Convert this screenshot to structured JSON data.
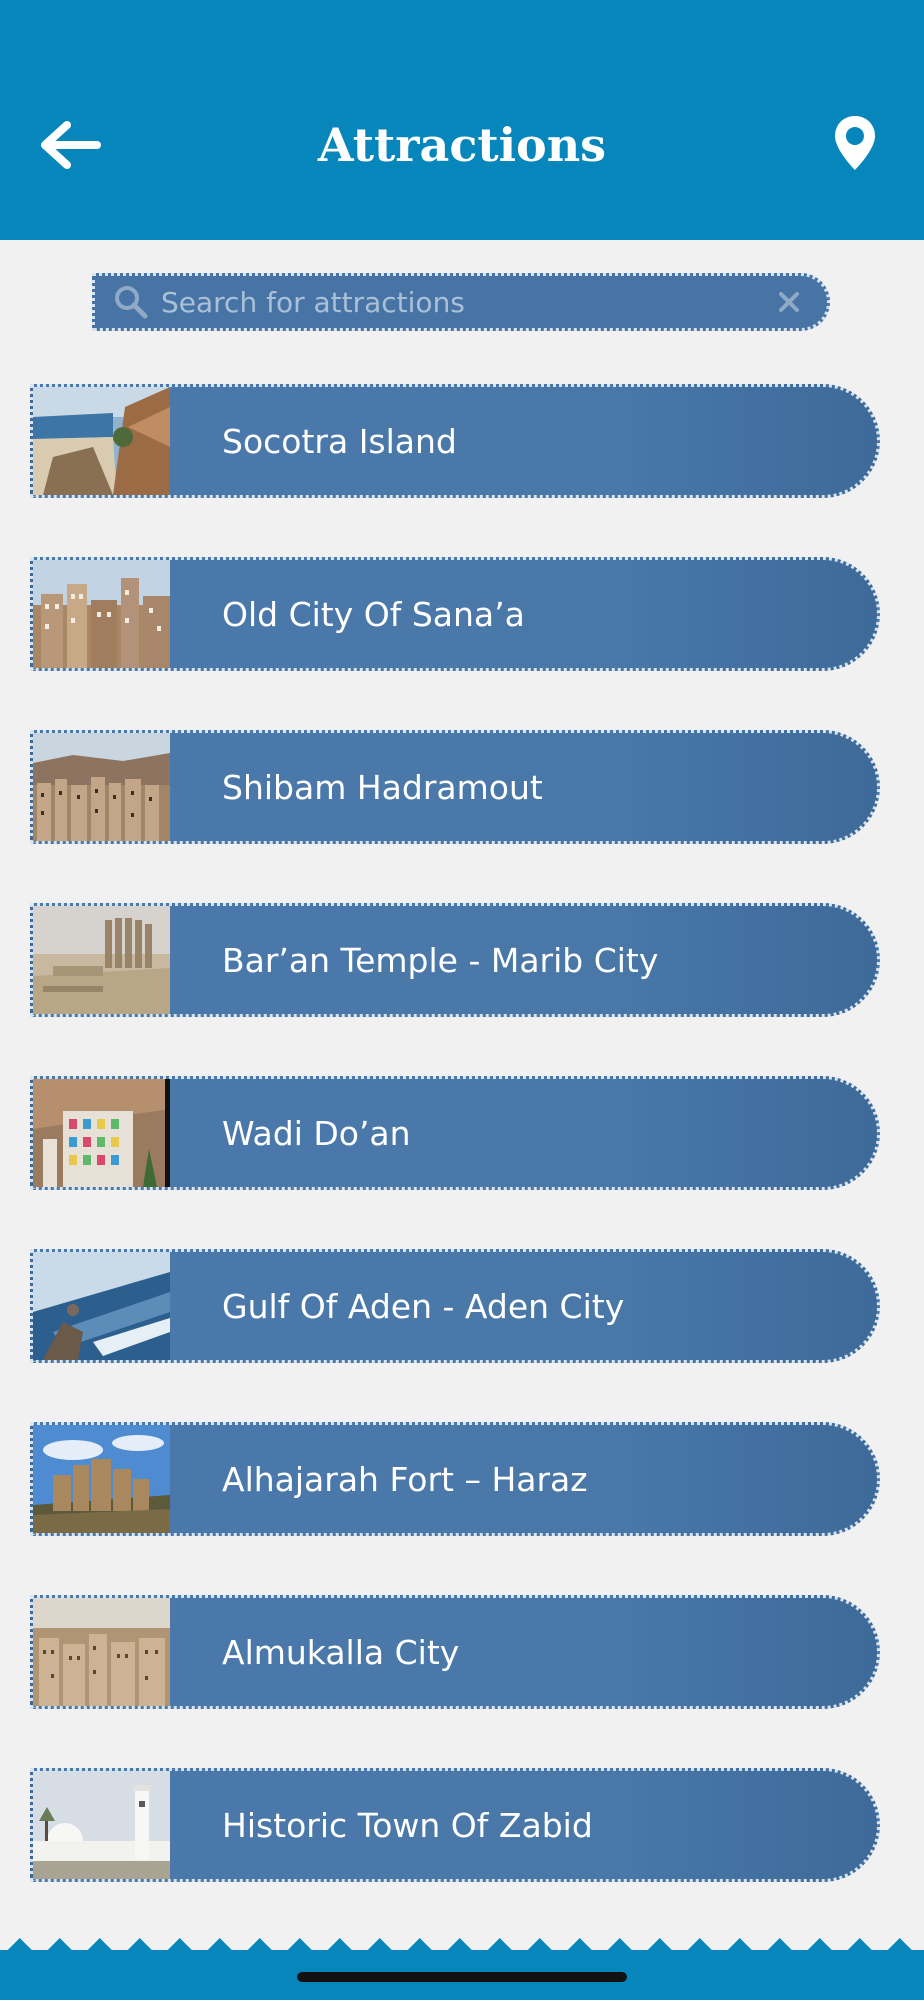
{
  "header": {
    "title": "Attractions",
    "back_icon": "back-arrow-icon",
    "map_icon": "map-pin-icon"
  },
  "search": {
    "placeholder": "Search for attractions",
    "value": "",
    "clear_icon": "close-icon"
  },
  "attractions": [
    {
      "label": "Socotra Island",
      "thumb": "socotra"
    },
    {
      "label": "Old City Of Sana’a",
      "thumb": "sanaa"
    },
    {
      "label": "Shibam Hadramout",
      "thumb": "shibam"
    },
    {
      "label": "Bar’an Temple - Marib City",
      "thumb": "baran"
    },
    {
      "label": "Wadi Do’an",
      "thumb": "wadi"
    },
    {
      "label": "Gulf Of Aden - Aden City",
      "thumb": "aden"
    },
    {
      "label": "Alhajarah Fort – Haraz",
      "thumb": "haraz"
    },
    {
      "label": "Almukalla City",
      "thumb": "mukalla"
    },
    {
      "label": "Historic Town Of Zabid",
      "thumb": "zabid"
    }
  ],
  "colors": {
    "header": "#0786bb",
    "item": "#4874a5",
    "background": "#f1f1f1"
  }
}
